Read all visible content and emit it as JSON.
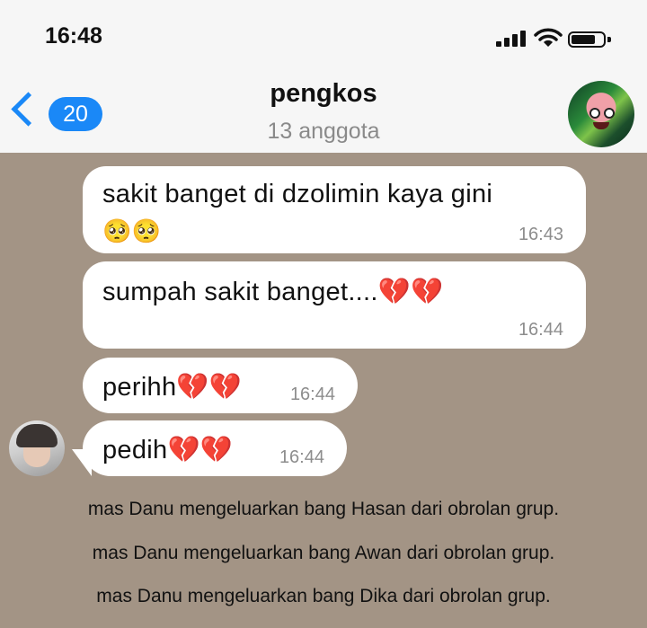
{
  "status_bar": {
    "time": "16:48"
  },
  "header": {
    "unread_count": "20",
    "group_name": "pengkos",
    "member_count": "13 anggota"
  },
  "messages": [
    {
      "text_line1": "sakit banget di dzolimin kaya gini",
      "text_line2": "🥺🥺",
      "time": "16:43"
    },
    {
      "text": "sumpah sakit banget....💔💔",
      "time": "16:44"
    },
    {
      "text": "perihh💔💔",
      "time": "16:44"
    },
    {
      "text": "pedih💔💔",
      "time": "16:44"
    }
  ],
  "system_messages": [
    "mas Danu mengeluarkan bang Hasan dari obrolan grup.",
    "mas Danu mengeluarkan bang Awan dari obrolan grup.",
    "mas Danu mengeluarkan bang Dika dari obrolan grup."
  ],
  "colors": {
    "accent": "#1a88f7",
    "chat_background": "#a39485",
    "bubble": "#ffffff",
    "header_background": "#f6f6f6"
  }
}
